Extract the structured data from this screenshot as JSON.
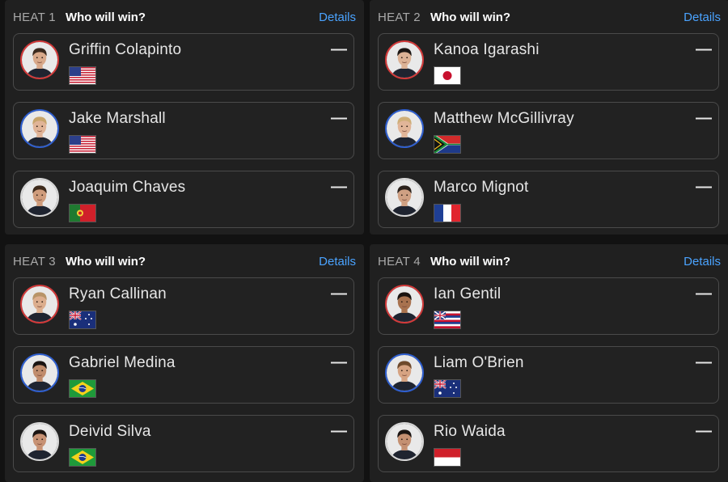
{
  "heats": [
    {
      "label": "HEAT 1",
      "question": "Who will win?",
      "details": "Details",
      "athletes": [
        {
          "name": "Griffin Colapinto",
          "odds": "—",
          "flag": "usa-flag",
          "ring": "#d33a3a",
          "skin": "#d8a98a",
          "hair": "#3b2a1e"
        },
        {
          "name": "Jake Marshall",
          "odds": "—",
          "flag": "usa-flag",
          "ring": "#2f5fd0",
          "skin": "#e0b497",
          "hair": "#c7a46a"
        },
        {
          "name": "Joaquim Chaves",
          "odds": "—",
          "flag": "portugal-flag",
          "ring": "#d7d7d7",
          "skin": "#cf9c7c",
          "hair": "#3d2a1c"
        }
      ]
    },
    {
      "label": "HEAT 2",
      "question": "Who will win?",
      "details": "Details",
      "athletes": [
        {
          "name": "Kanoa Igarashi",
          "odds": "—",
          "flag": "japan-flag",
          "ring": "#d33a3a",
          "skin": "#dcb295",
          "hair": "#1c1714"
        },
        {
          "name": "Matthew McGillivray",
          "odds": "—",
          "flag": "south-africa-flag",
          "ring": "#2f5fd0",
          "skin": "#e1b598",
          "hair": "#cfae78"
        },
        {
          "name": "Marco Mignot",
          "odds": "—",
          "flag": "france-flag",
          "ring": "#d7d7d7",
          "skin": "#cfa083",
          "hair": "#2b221c"
        }
      ]
    },
    {
      "label": "HEAT 3",
      "question": "Who will win?",
      "details": "Details",
      "athletes": [
        {
          "name": "Ryan Callinan",
          "odds": "—",
          "flag": "australia-flag",
          "ring": "#d33a3a",
          "skin": "#dcae8e",
          "hair": "#b89468"
        },
        {
          "name": "Gabriel Medina",
          "odds": "—",
          "flag": "brazil-flag",
          "ring": "#2f5fd0",
          "skin": "#c08c6c",
          "hair": "#1a1412"
        },
        {
          "name": "Deivid Silva",
          "odds": "—",
          "flag": "brazil-flag",
          "ring": "#d7d7d7",
          "skin": "#c79274",
          "hair": "#1c1512"
        }
      ]
    },
    {
      "label": "HEAT 4",
      "question": "Who will win?",
      "details": "Details",
      "athletes": [
        {
          "name": "Ian Gentil",
          "odds": "—",
          "flag": "hawaii-flag",
          "ring": "#d33a3a",
          "skin": "#a8724f",
          "hair": "#1a1310"
        },
        {
          "name": "Liam O'Brien",
          "odds": "—",
          "flag": "australia-flag",
          "ring": "#2f5fd0",
          "skin": "#d6a382",
          "hair": "#6e4a2c"
        },
        {
          "name": "Rio Waida",
          "odds": "—",
          "flag": "indonesia-flag",
          "ring": "#d7d7d7",
          "skin": "#c49072",
          "hair": "#1a1412"
        }
      ]
    }
  ],
  "colors": {
    "background": "#121212",
    "panel": "#202020",
    "card_border": "#4a4a4a",
    "link": "#4aa3ff",
    "text": "#e6e6e6",
    "muted": "#a9a9a9"
  }
}
